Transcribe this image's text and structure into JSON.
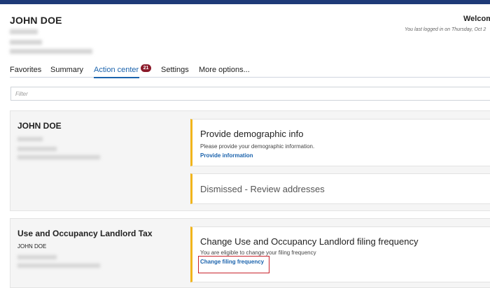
{
  "header": {
    "name": "JOHN DOE",
    "welcome": "Welcom",
    "last_login": "You last logged in on Thursday, Oct 2"
  },
  "tabs": [
    {
      "label": "Favorites"
    },
    {
      "label": "Summary"
    },
    {
      "label": "Action center",
      "badge": "21",
      "active": true
    },
    {
      "label": "Settings"
    },
    {
      "label": "More options..."
    }
  ],
  "filter": {
    "placeholder": "Filter",
    "value": ""
  },
  "accounts": [
    {
      "title": "JOHN DOE",
      "cards": [
        {
          "title": "Provide demographic info",
          "description": "Please provide your demographic information.",
          "link": "Provide information"
        },
        {
          "title": "Dismissed - Review addresses"
        }
      ]
    },
    {
      "title": "Use and Occupancy Landlord Tax",
      "subtitle": "JOHN DOE",
      "cards": [
        {
          "title": "Change Use and Occupancy Landlord filing frequency",
          "description": "You are eligible to change your filing frequency",
          "link": "Change filing frequency"
        }
      ]
    }
  ],
  "colors": {
    "topbar": "#1e3a78",
    "accent": "#1b63ad",
    "card_border": "#f1b51c",
    "badge": "#8b1a2a",
    "highlight": "#c8232c"
  }
}
